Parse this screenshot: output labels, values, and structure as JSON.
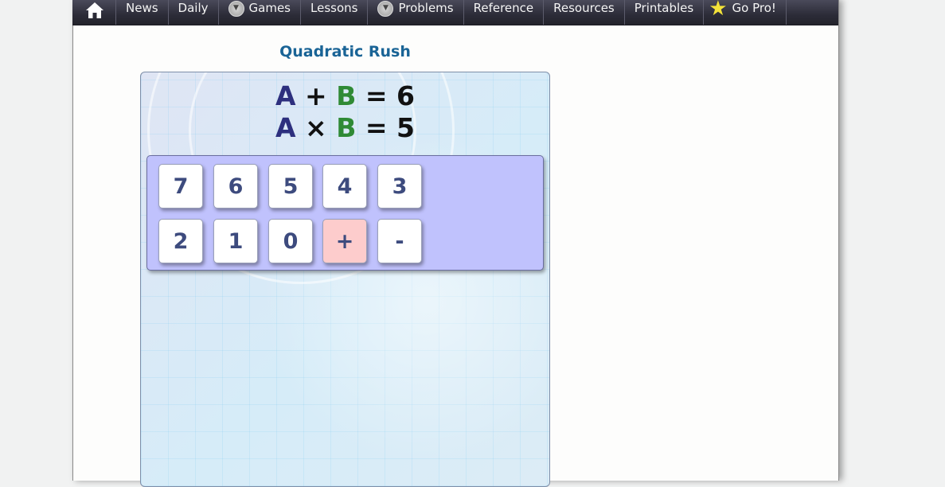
{
  "nav": {
    "items": [
      {
        "label": "News"
      },
      {
        "label": "Daily"
      },
      {
        "label": "Games"
      },
      {
        "label": "Lessons"
      },
      {
        "label": "Problems"
      },
      {
        "label": "Reference"
      },
      {
        "label": "Resources"
      },
      {
        "label": "Printables"
      },
      {
        "label": "Go Pro!"
      }
    ]
  },
  "game": {
    "title": "Quadratic Rush",
    "eq1": {
      "a": "A",
      "op": "+",
      "b": "B",
      "eq": "=",
      "result": "6"
    },
    "eq2": {
      "a": "A",
      "op": "×",
      "b": "B",
      "eq": "=",
      "result": "5"
    },
    "keys_row1": [
      "7",
      "6",
      "5",
      "4",
      "3"
    ],
    "keys_row2": [
      "2",
      "1",
      "0",
      "+",
      "-"
    ]
  },
  "colors": {
    "title": "#1a6496",
    "var_a": "#2d2f7e",
    "var_b": "#2f8a35",
    "key_panel": "#c0c2fd",
    "plus_key": "#fdcccc"
  }
}
